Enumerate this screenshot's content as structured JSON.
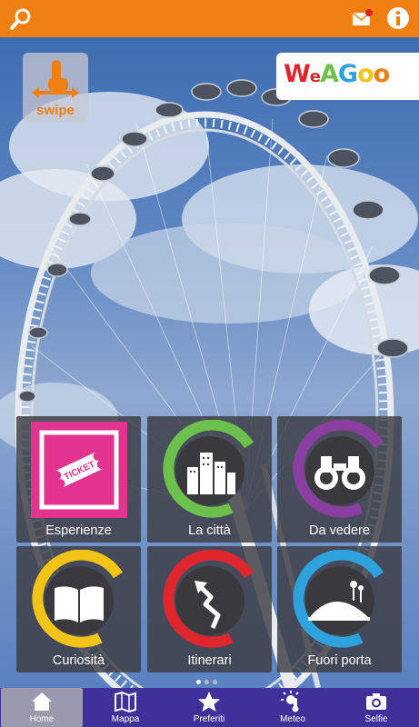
{
  "topbar": {
    "background": "#f07f12",
    "icons": [
      "search-icon",
      "mail-icon",
      "info-icon"
    ]
  },
  "logos": {
    "swipe_text": "swipe",
    "weagoo_letters": [
      "W",
      "e",
      "A",
      "G",
      "o",
      "o"
    ]
  },
  "tiles": [
    {
      "label": "Esperienze",
      "icon": "ticket-icon",
      "color": "#e2338f"
    },
    {
      "label": "La città",
      "icon": "city-icon",
      "color": "#6cc14d"
    },
    {
      "label": "Da vedere",
      "icon": "binoculars-icon",
      "color": "#8a3ea0"
    },
    {
      "label": "Curiosità",
      "icon": "book-icon",
      "color": "#f3c418"
    },
    {
      "label": "Itinerari",
      "icon": "route-icon",
      "color": "#e0262d"
    },
    {
      "label": "Fuori porta",
      "icon": "hill-icon",
      "color": "#2ea2dc"
    }
  ],
  "pager": {
    "count": 3,
    "active_index": 0
  },
  "bottom_nav": {
    "items": [
      {
        "label": "Home",
        "icon": "home-icon",
        "active": true
      },
      {
        "label": "Mappa",
        "icon": "map-icon",
        "active": false
      },
      {
        "label": "Preferiti",
        "icon": "star-icon",
        "active": false
      },
      {
        "label": "Meteo",
        "icon": "weather-icon",
        "active": false
      },
      {
        "label": "Selfie",
        "icon": "camera-icon",
        "active": false
      }
    ],
    "background": "#40309a"
  }
}
